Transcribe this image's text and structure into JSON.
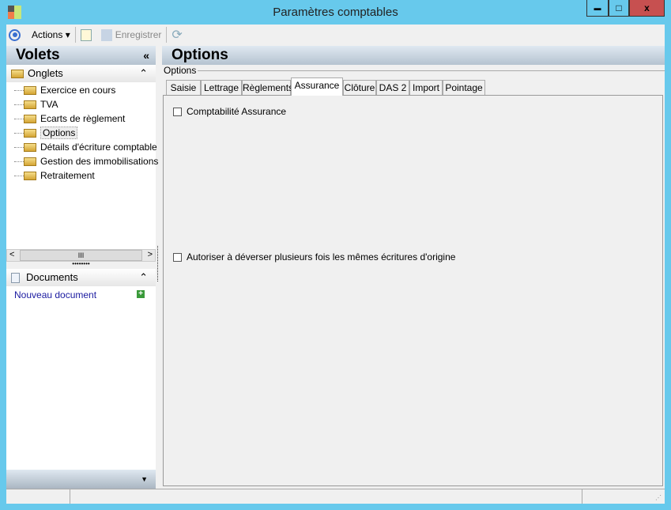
{
  "window": {
    "title": "Paramètres comptables",
    "minimize": "▬",
    "maximize": "□",
    "close": "x"
  },
  "toolbar": {
    "actions": "Actions",
    "save": "Enregistrer"
  },
  "left": {
    "header": "Volets",
    "collapse": "«",
    "onglets": {
      "label": "Onglets",
      "items": [
        "Exercice en cours",
        "TVA",
        "Ecarts de règlement",
        "Options",
        "Détails d'écriture comptable",
        "Gestion des immobilisations",
        "Retraitement"
      ],
      "selected": "Options"
    },
    "scroll": {
      "left": "<",
      "right": ">",
      "thumb": "III"
    },
    "documents": {
      "label": "Documents",
      "new": "Nouveau document"
    }
  },
  "main": {
    "header": "Options",
    "group": "Options",
    "tabs": [
      "Saisie",
      "Lettrage",
      "Règlements",
      "Assurance",
      "Clôture",
      "DAS 2",
      "Import",
      "Pointage"
    ],
    "active": "Assurance",
    "checkboxes": [
      {
        "label": "Comptabilité Assurance",
        "checked": false
      },
      {
        "label": "Autoriser à déverser plusieurs fois les mêmes écritures d'origine",
        "checked": false
      }
    ]
  }
}
